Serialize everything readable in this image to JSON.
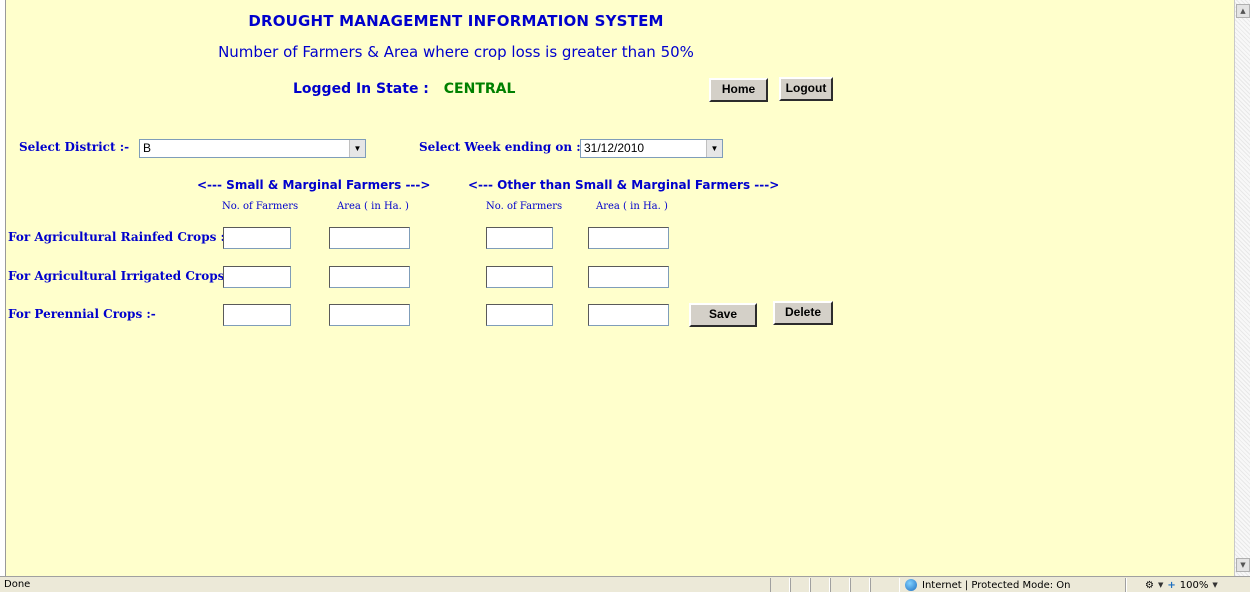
{
  "header": {
    "title": "DROUGHT MANAGEMENT INFORMATION SYSTEM",
    "subtitle": "Number of Farmers & Area where crop loss is greater than 50%",
    "state_label": "Logged In State :",
    "state_value": "CENTRAL",
    "home_label": "Home",
    "logout_label": "Logout"
  },
  "filters": {
    "district_label": "Select District :-",
    "district_value": "B",
    "week_label": "Select Week ending on :-",
    "week_value": "31/12/2010"
  },
  "groups": {
    "small": "<--- Small & Marginal Farmers --->",
    "other": "<--- Other than Small & Marginal Farmers --->"
  },
  "columns": [
    "No. of Farmers",
    "Area ( in Ha. )",
    "No. of Farmers",
    "Area ( in Ha. )"
  ],
  "rows": [
    {
      "label": "For Agricultural Rainfed Crops :-"
    },
    {
      "label": "For Agricultural Irrigated Crops:-"
    },
    {
      "label": "For Perennial Crops :-"
    }
  ],
  "actions": {
    "save_label": "Save",
    "delete_label": "Delete"
  },
  "statusbar": {
    "status": "Done",
    "zone": "Internet | Protected Mode: On",
    "zoom": "100%"
  }
}
